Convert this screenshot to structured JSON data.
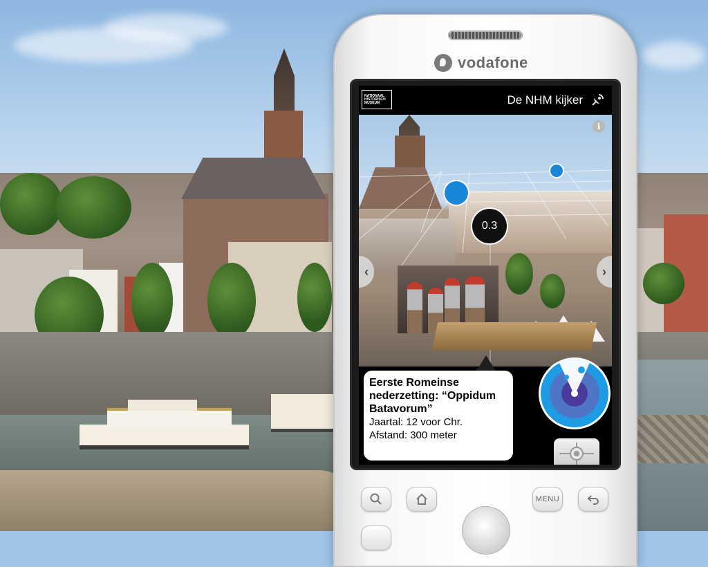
{
  "phone": {
    "carrier": "vodafone"
  },
  "app": {
    "logo_text": "NATIONAAL HISTORISCH MUSEUM",
    "title": "De NHM kijker",
    "info_icon": "i",
    "distance_bubble": "0.3",
    "nav_left": "‹",
    "nav_right": "›"
  },
  "popup": {
    "title": "Eerste Romeinse nederzetting: “Oppidum Batavorum”",
    "year": "Jaartal: 12 voor Chr.",
    "distance": "Afstand: 300 meter"
  },
  "hardware_buttons": {
    "search": "search-icon",
    "home": "home-icon",
    "menu": "MENU",
    "back": "back-icon"
  },
  "colors": {
    "poi_blue": "#1a86d8",
    "radar_blue": "#1e9be3",
    "radar_purple": "#4a3a9b"
  }
}
